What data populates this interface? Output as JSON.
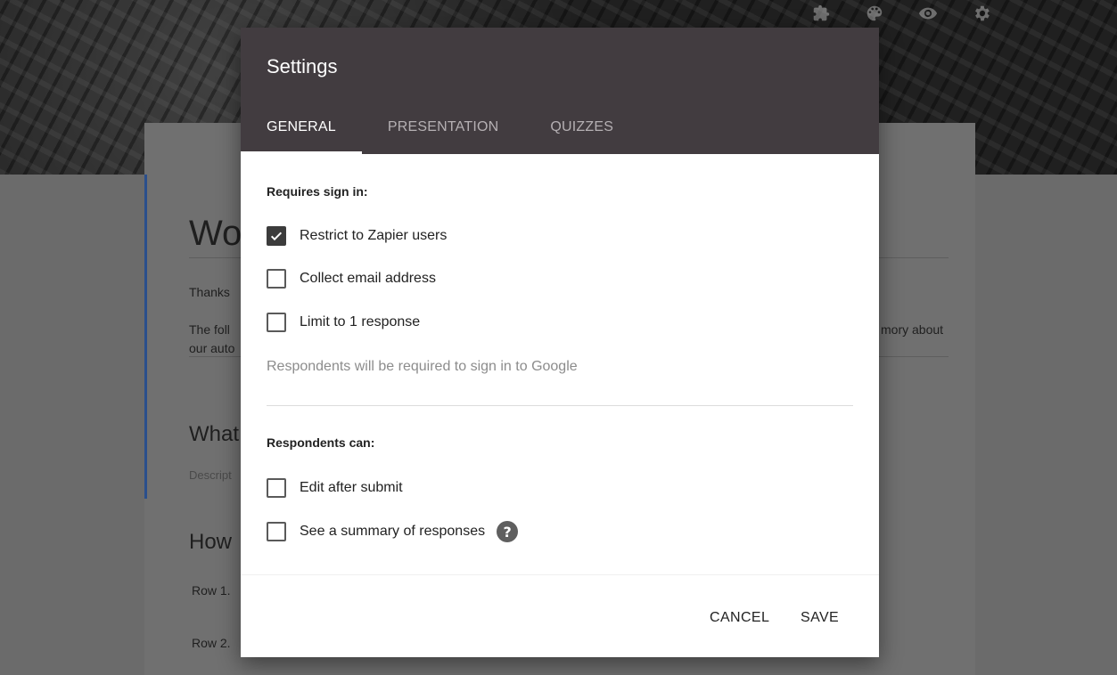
{
  "background_form": {
    "title_partial": "Wo",
    "thanks_partial": "Thanks",
    "following_partial": "The foll",
    "following_line2_partial": "our auto",
    "memory_partial": "mory about",
    "what_partial": "What",
    "desc_partial": "Descript",
    "how_partial": "How",
    "row1": "Row 1.",
    "row2": "Row 2."
  },
  "top_icons": [
    "puzzle-icon",
    "palette-icon",
    "eye-icon",
    "gear-icon"
  ],
  "dialog": {
    "title": "Settings",
    "tabs": [
      {
        "label": "GENERAL",
        "active": true
      },
      {
        "label": "PRESENTATION",
        "active": false
      },
      {
        "label": "QUIZZES",
        "active": false
      }
    ],
    "section_sign_in": "Requires sign in:",
    "options_sign_in": [
      {
        "label": "Restrict to Zapier users",
        "checked": true
      },
      {
        "label": "Collect email address",
        "checked": false
      },
      {
        "label": "Limit to 1 response",
        "checked": false
      }
    ],
    "note": "Respondents will be required to sign in to Google",
    "section_respondents": "Respondents can:",
    "options_respondents": [
      {
        "label": "Edit after submit",
        "checked": false
      },
      {
        "label": "See a summary of responses",
        "checked": false
      }
    ],
    "help_glyph": "?",
    "cancel_label": "CANCEL",
    "save_label": "SAVE"
  },
  "colors": {
    "header": "#423c40",
    "accent": "#2a4f8c"
  }
}
